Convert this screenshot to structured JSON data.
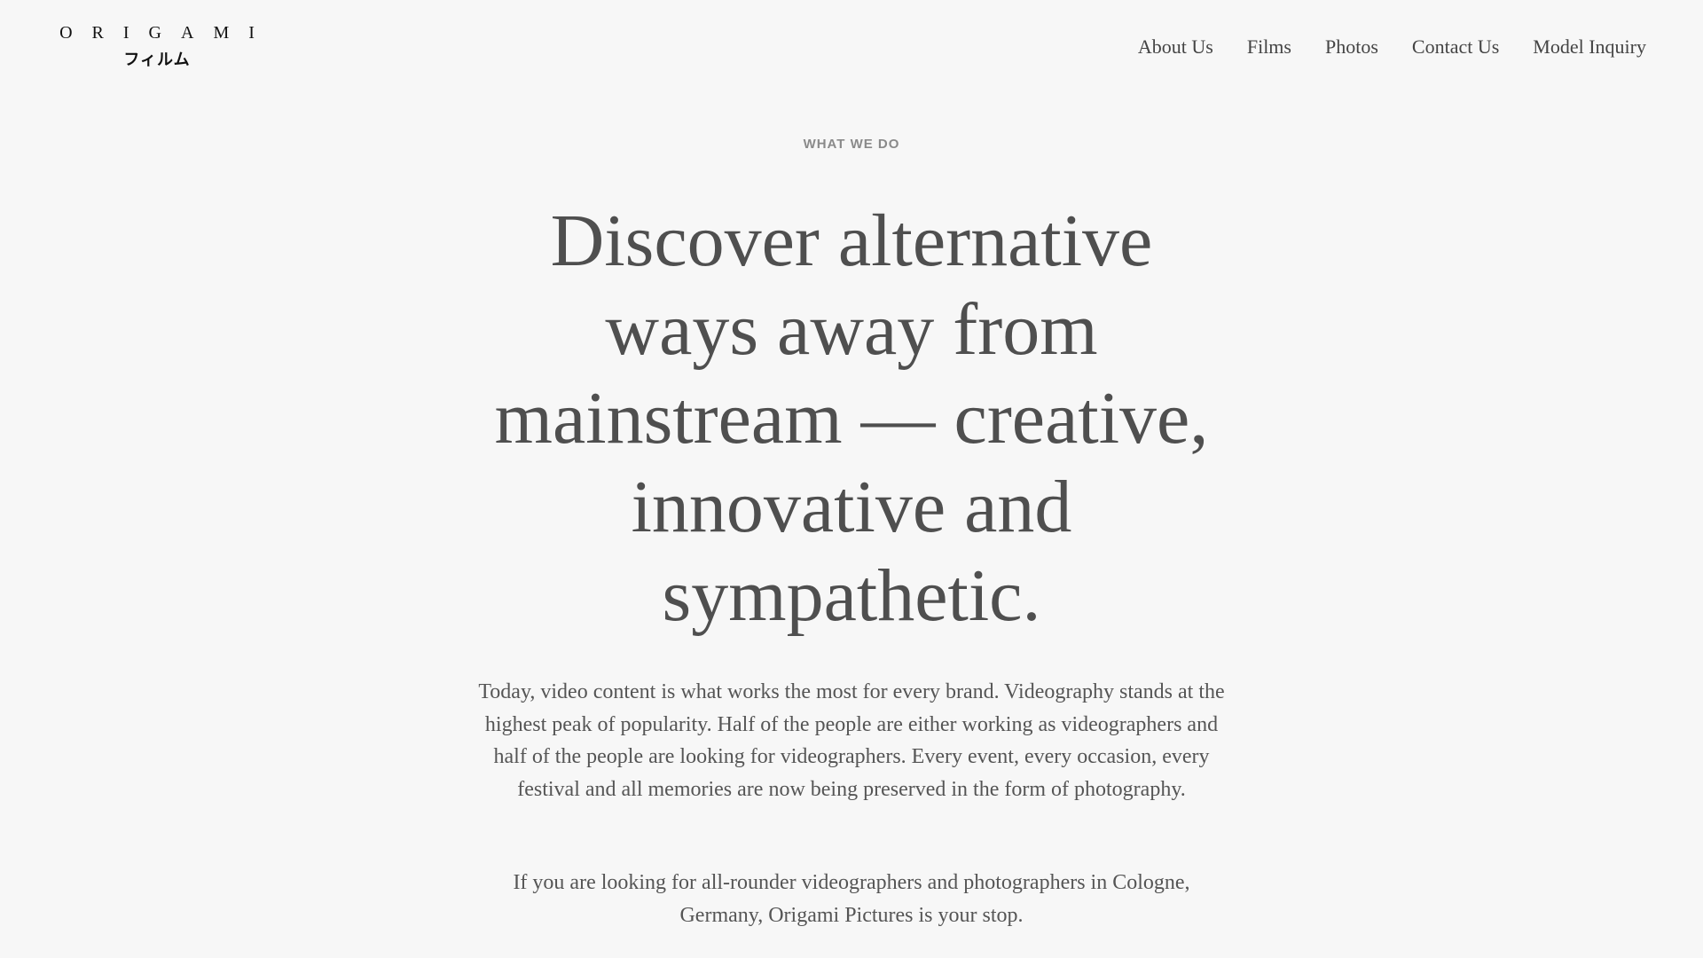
{
  "header": {
    "logo_word": "ORIGAMI",
    "logo_sub": "フィルム",
    "nav": [
      {
        "label": "About Us"
      },
      {
        "label": "Films"
      },
      {
        "label": "Photos"
      },
      {
        "label": "Contact Us"
      },
      {
        "label": "Model Inquiry"
      }
    ]
  },
  "main": {
    "eyebrow": "WHAT WE DO",
    "headline": "Discover alternative ways away from mainstream — creative, innovative and sympathetic.",
    "paragraphs": [
      "Today, video content is what works the most for every brand. Videography stands at the highest peak of popularity. Half of the people are either working as videographers and half of the people are looking for videographers. Every event, every occasion, every festival and all memories are now being preserved in the form of photography.",
      "If you are looking for all-rounder videographers and photographers in Cologne, Germany, Origami Pictures is your stop."
    ]
  }
}
